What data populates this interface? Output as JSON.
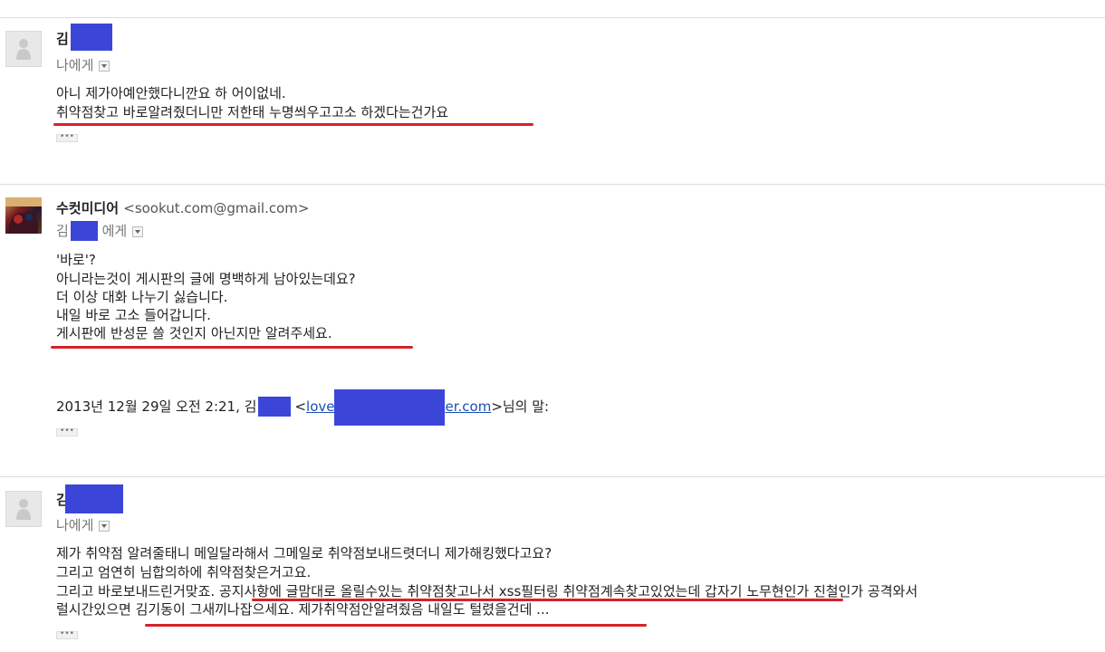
{
  "messages": [
    {
      "sender": "김",
      "recipient": "나에게",
      "lines": [
        "아니 제가아예안했다니깐요 하 어이없네.",
        "취약점찾고 바로알려줬더니만 저한태 누명씌우고고소 하겠다는건가요"
      ],
      "more": "•••"
    },
    {
      "sender": "수컷미디어",
      "email": "<sookut.com@gmail.com>",
      "recipient_prefix": "김",
      "recipient_suffix": "에게",
      "lines": [
        "'바로'?",
        "아니라는것이 게시판의 글에 명백하게 남아있는데요?",
        "더 이상 대화 나누기 싫습니다.",
        "내일 바로 고소 들어갑니다.",
        "게시판에 반성문 쓸 것인지 아닌지만 알려주세요."
      ],
      "quote": {
        "prefix": "2013년 12월 29일 오전 2:21, 김",
        "open_bracket": "<",
        "link_start": "love",
        "link_end": "er.com",
        "close_suffix": ">님의 말:"
      },
      "more": "•••"
    },
    {
      "sender": "김",
      "recipient": "나에게",
      "lines": [
        "제가 취약점 알려줄태니 메일달라해서 그메일로 취약점보내드렷더니 제가해킹했다고요?",
        "그리고 엄연히 님합의하에 취약점찾은거고요.",
        "그리고 바로보내드린거맞죠. 공지사항에 글맘대로 올릴수있는 취약점찾고나서 xss필터링 취약점계속찾고있었는데 갑자기 노무현인가 진철인가 공격와서",
        "럴시간있으면 김기동이 그새끼나잡으세요. 제가취약점안알려줬음 내일도 털렸을건데 ..."
      ],
      "more": "•••"
    }
  ]
}
